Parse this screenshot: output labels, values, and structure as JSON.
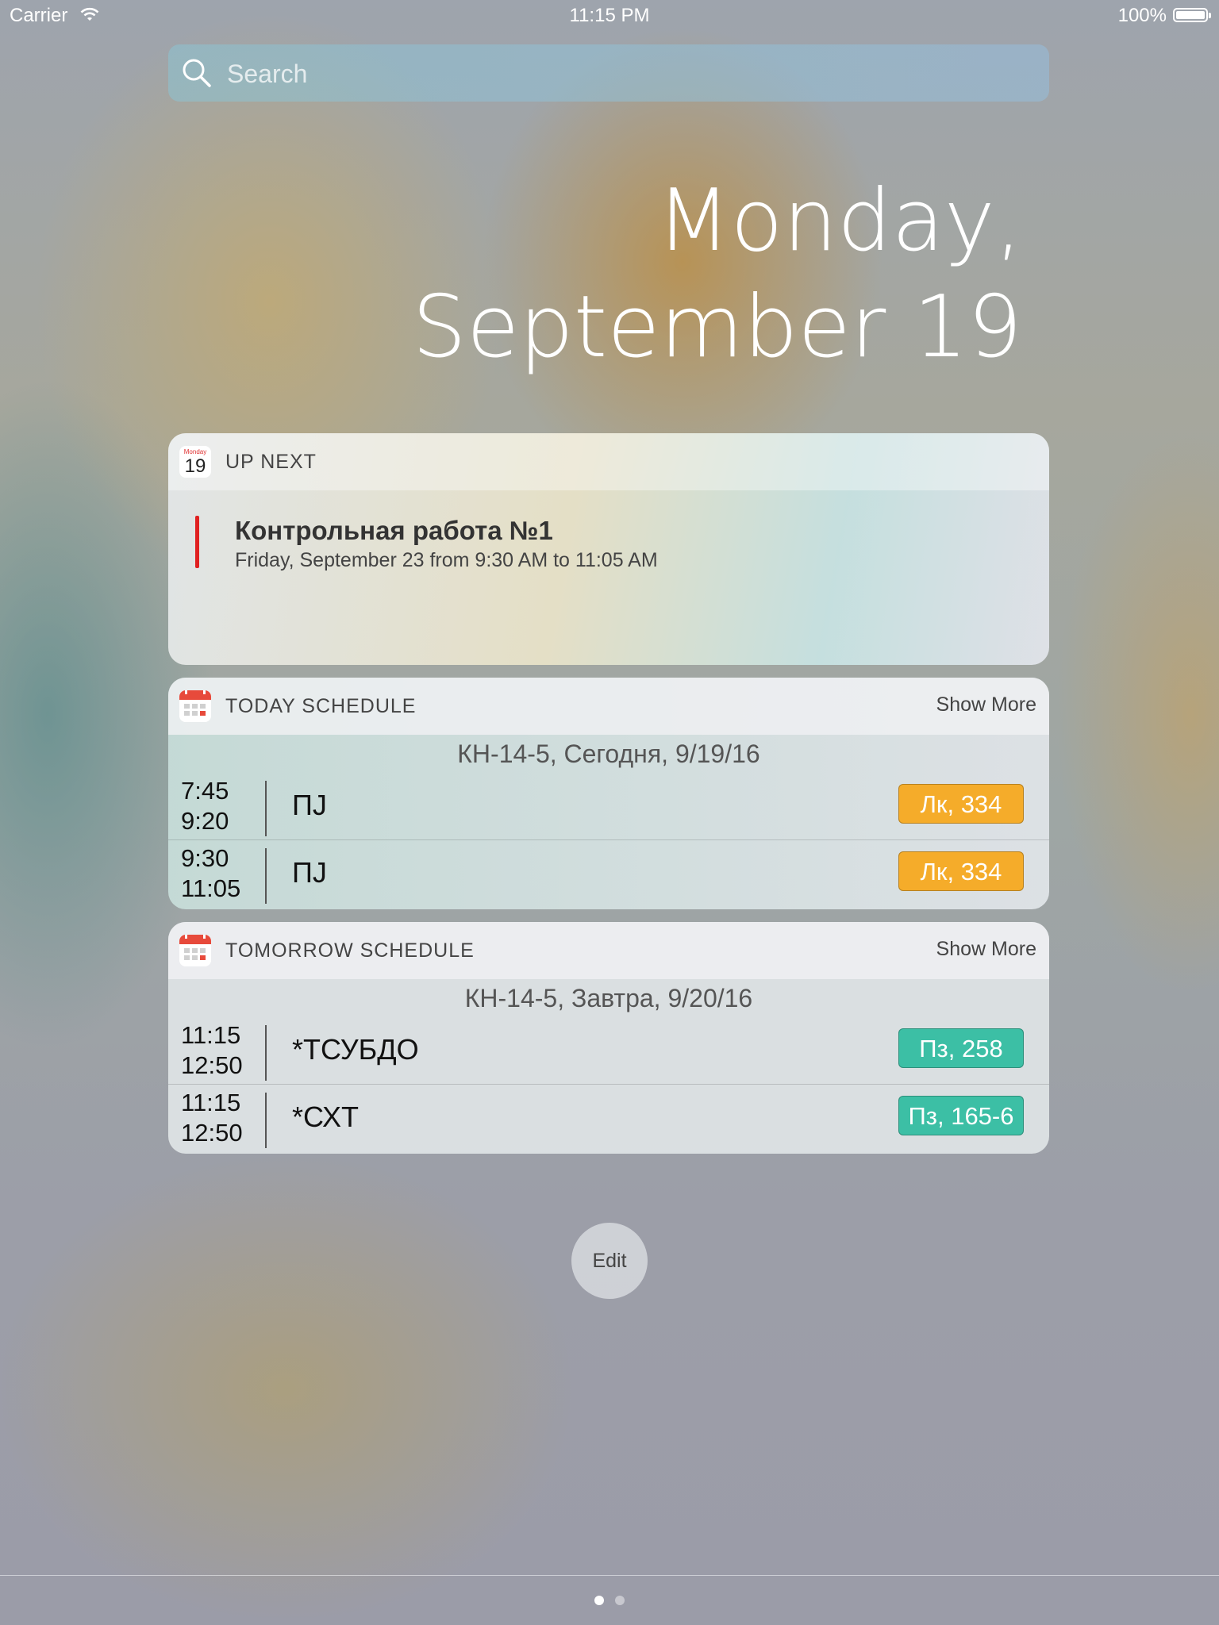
{
  "status_bar": {
    "carrier": "Carrier",
    "time": "11:15 PM",
    "battery": "100%"
  },
  "search": {
    "placeholder": "Search"
  },
  "date": {
    "line1": "Monday,",
    "line2": "September 19"
  },
  "up_next": {
    "title": "UP NEXT",
    "icon": {
      "month": "Monday",
      "day": "19"
    },
    "event": {
      "name": "Контрольная работа №1",
      "time": "Friday, September 23 from 9:30 AM to 11:05 AM",
      "color": "#e02020"
    }
  },
  "today_schedule": {
    "title": "TODAY SCHEDULE",
    "show_more": "Show More",
    "subtitle": "КН-14-5, Сегодня, 9/19/16",
    "rows": [
      {
        "start": "7:45",
        "end": "9:20",
        "subject": "ПJ",
        "badge": "Лк, 334",
        "badge_color": "#f5ac2a"
      },
      {
        "start": "9:30",
        "end": "11:05",
        "subject": "ПJ",
        "badge": "Лк, 334",
        "badge_color": "#f5ac2a"
      }
    ]
  },
  "tomorrow_schedule": {
    "title": "TOMORROW SCHEDULE",
    "show_more": "Show More",
    "subtitle": "КН-14-5, Завтра, 9/20/16",
    "rows": [
      {
        "start": "11:15",
        "end": "12:50",
        "subject": "*ТСУБДО",
        "badge": "Пз, 258",
        "badge_color": "#3cbfa5"
      },
      {
        "start": "11:15",
        "end": "12:50",
        "subject": "*СХТ",
        "badge": "Пз, 165-6",
        "badge_color": "#3cbfa5"
      }
    ]
  },
  "edit_button": "Edit",
  "page_dots": {
    "count": 2,
    "active": 0
  }
}
